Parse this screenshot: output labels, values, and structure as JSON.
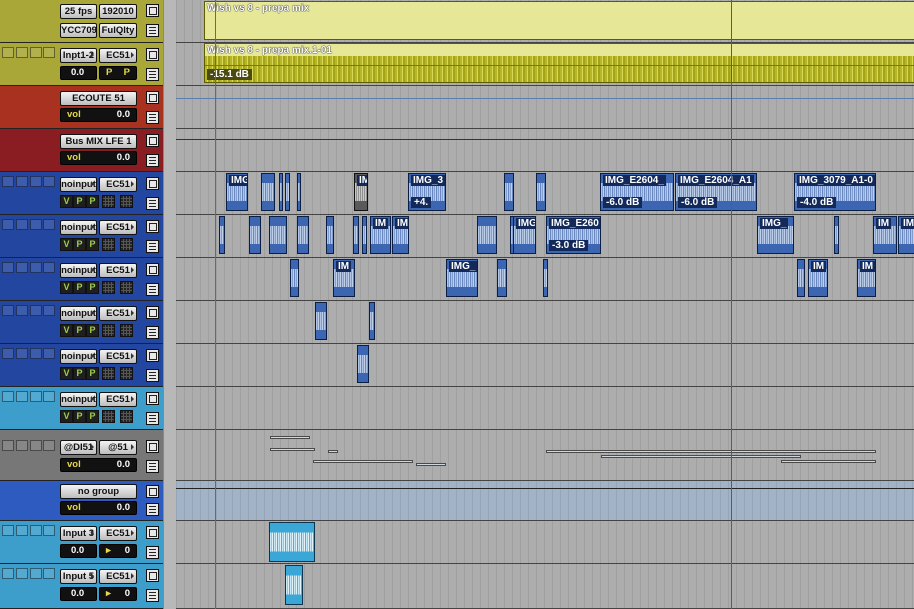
{
  "colors": {
    "yellow": "#a9a82f",
    "red": "#a2301f",
    "darkred": "#8b1a1f",
    "blue": "#2448a2",
    "lightblue": "#3f9fcf",
    "grey": "#7a7a7a",
    "groupblue": "#3a62c0"
  },
  "tracks": [
    {
      "id": "video",
      "color": "#a8a738",
      "buttons": {
        "fps": "25 fps",
        "tc": "192010",
        "space": "YCC709",
        "quality": "FulQlty"
      }
    },
    {
      "id": "master",
      "color": "#a8a738",
      "input": "Inpt1-2",
      "output": "EC51",
      "vol": "0.0",
      "p1": "P",
      "p2": "P"
    },
    {
      "id": "ecoute",
      "color": "#a8321f",
      "name": "ECOUTE 51",
      "label": "vol",
      "vol": "0.0"
    },
    {
      "id": "busmix",
      "color": "#8a1d22",
      "name": "Bus MIX LFE 1",
      "label": "vol",
      "vol": "0.0"
    },
    {
      "id": "a1",
      "color": "#2347a1",
      "input": "noinput",
      "output": "EC51",
      "v": "V",
      "p1": "P",
      "p2": "P"
    },
    {
      "id": "a2",
      "color": "#2347a1",
      "input": "noinput",
      "output": "EC51",
      "v": "V",
      "p1": "P",
      "p2": "P"
    },
    {
      "id": "a3",
      "color": "#2347a1",
      "input": "noinput",
      "output": "EC51",
      "v": "V",
      "p1": "P",
      "p2": "P"
    },
    {
      "id": "a4",
      "color": "#2347a1",
      "input": "noinput",
      "output": "EC51",
      "v": "V",
      "p1": "P",
      "p2": "P"
    },
    {
      "id": "a5",
      "color": "#2347a1",
      "input": "noinput",
      "output": "EC51",
      "v": "V",
      "p1": "P",
      "p2": "P"
    },
    {
      "id": "a6",
      "color": "#3d9ecb",
      "input": "noinput",
      "output": "EC51",
      "v": "V",
      "p1": "P",
      "p2": "P"
    },
    {
      "id": "di",
      "color": "#777777",
      "input": "@DI51",
      "output": "@51",
      "label": "vol",
      "vol": "0.0"
    },
    {
      "id": "group",
      "color": "#2e5bbf",
      "name": "no group",
      "label": "vol",
      "vol": "0.0"
    },
    {
      "id": "in3",
      "color": "#3d9ecb",
      "input": "Input 3",
      "output": "EC51",
      "vol": "0.0",
      "pan": "0"
    },
    {
      "id": "in5",
      "color": "#3d9ecb",
      "input": "Input 5",
      "output": "EC51",
      "vol": "0.0",
      "pan": "0"
    }
  ],
  "clips": {
    "video_title": "Wish vs 8 - prepa mix",
    "audio_title": "Wish vs 8 - prepa mix.1-01",
    "audio_gain": "-15.1 dB",
    "a1": [
      {
        "name": "IMG"
      },
      {
        "name": ""
      },
      {
        "name": ""
      },
      {
        "name": ""
      },
      {
        "name": ""
      },
      {
        "name": "IM"
      },
      {
        "name": "IMG_3",
        "gain": "+4."
      },
      {
        "name": ""
      },
      {
        "name": ""
      },
      {
        "name": "IMG_E2604_",
        "gain": "-6.0 dB"
      },
      {
        "name": "IMG_E2604_A1",
        "gain": "-6.0 dB"
      },
      {
        "name": "IMG_3079_A1-0",
        "gain": "-4.0 dB"
      }
    ],
    "a2": [
      {
        "name": ""
      },
      {
        "name": ""
      },
      {
        "name": ""
      },
      {
        "name": ""
      },
      {
        "name": ""
      },
      {
        "name": ""
      },
      {
        "name": ""
      },
      {
        "name": "IM"
      },
      {
        "name": "IM"
      },
      {
        "name": ""
      },
      {
        "name": ""
      },
      {
        "name": "IMG"
      },
      {
        "name": "IMG_E260",
        "gain": "-3.0 dB"
      },
      {
        "name": "IMG_"
      },
      {
        "name": ""
      },
      {
        "name": "IM"
      },
      {
        "name": "IM"
      }
    ],
    "a3": [
      {
        "name": ""
      },
      {
        "name": "IM"
      },
      {
        "name": "IMG_"
      },
      {
        "name": ""
      },
      {
        "name": ""
      },
      {
        "name": ""
      },
      {
        "name": "IM"
      },
      {
        "name": "IM"
      }
    ]
  }
}
